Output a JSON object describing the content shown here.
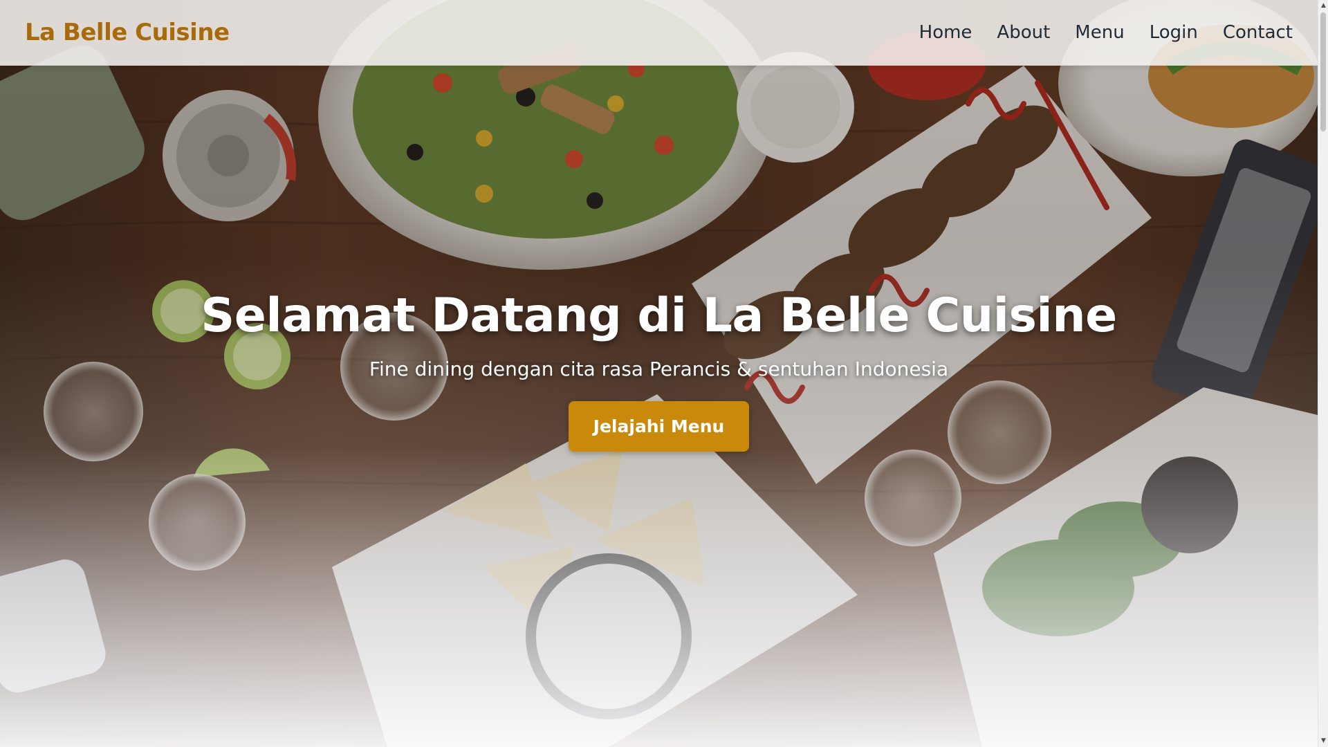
{
  "navbar": {
    "brand": "La Belle Cuisine",
    "links": [
      {
        "label": "Home"
      },
      {
        "label": "About"
      },
      {
        "label": "Menu"
      },
      {
        "label": "Login"
      },
      {
        "label": "Contact"
      }
    ]
  },
  "hero": {
    "title": "Selamat Datang di La Belle Cuisine",
    "subtitle": "Fine dining dengan cita rasa Perancis & sentuhan Indonesia",
    "cta_label": "Jelajahi Menu"
  },
  "scrollbar": {
    "up_icon": "arrow-up-icon",
    "down_icon": "arrow-down-icon"
  },
  "colors": {
    "brand": "#a86a0a",
    "cta": "#c98a0c",
    "nav_text": "#1f2a37"
  }
}
